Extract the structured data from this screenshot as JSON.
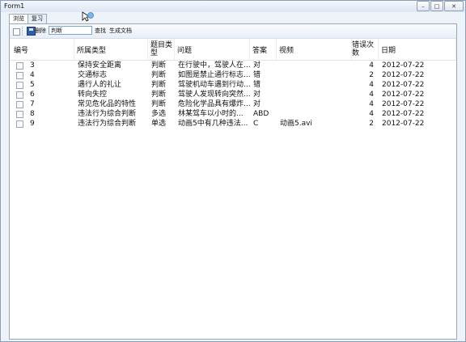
{
  "window": {
    "title": "Form1",
    "buttons": {
      "minimize": "–",
      "maximize": "□",
      "close": "✕"
    }
  },
  "tabs": [
    {
      "label": "浏览"
    },
    {
      "label": "复习"
    }
  ],
  "toolbar": {
    "delete_label": "删除",
    "search_value": "判断",
    "find_label": "查找",
    "generate_label": "生成文档"
  },
  "table": {
    "columns": [
      "编号",
      "所属类型",
      "题目类型",
      "问题",
      "答案",
      "视频",
      "错误次数",
      "日期"
    ],
    "rows": [
      {
        "id": "3",
        "category": "保持安全距离",
        "qtype": "判断",
        "question": "在行驶中，驾驶人在...",
        "answer": "对",
        "video": "",
        "errors": "4",
        "date": "2012-07-22"
      },
      {
        "id": "4",
        "category": "交通标志",
        "qtype": "判断",
        "question": "如图是禁止通行标志...",
        "answer": "错",
        "video": "",
        "errors": "2",
        "date": "2012-07-22"
      },
      {
        "id": "5",
        "category": "遇行人的礼让",
        "qtype": "判断",
        "question": "驾驶机动车遇到行动...",
        "answer": "错",
        "video": "",
        "errors": "4",
        "date": "2012-07-22"
      },
      {
        "id": "6",
        "category": "转向失控",
        "qtype": "判断",
        "question": "驾驶人发现转向突然...",
        "answer": "对",
        "video": "",
        "errors": "4",
        "date": "2012-07-22"
      },
      {
        "id": "7",
        "category": "常见危化品的特性",
        "qtype": "判断",
        "question": "危险化学品具有爆炸...",
        "answer": "对",
        "video": "",
        "errors": "4",
        "date": "2012-07-22"
      },
      {
        "id": "8",
        "category": "违法行为综合判断",
        "qtype": "多选",
        "question": "林某驾车以小时的...",
        "answer": "ABD",
        "video": "",
        "errors": "4",
        "date": "2012-07-22"
      },
      {
        "id": "9",
        "category": "违法行为综合判断",
        "qtype": "单选",
        "question": "动画5中有几种违法...",
        "answer": "C",
        "video": "动画5.avi",
        "errors": "2",
        "date": "2012-07-22"
      }
    ]
  }
}
